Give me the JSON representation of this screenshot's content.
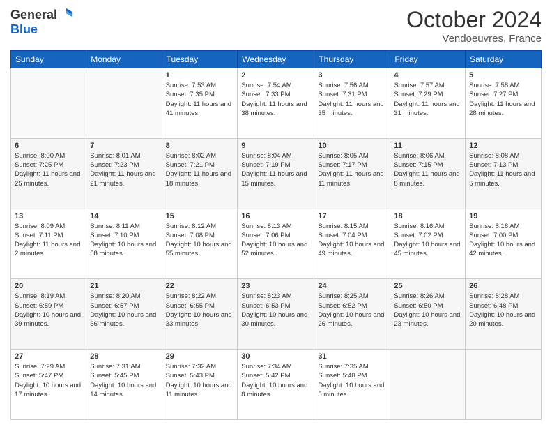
{
  "header": {
    "title": "October 2024",
    "location": "Vendoeuvres, France"
  },
  "columns": [
    "Sunday",
    "Monday",
    "Tuesday",
    "Wednesday",
    "Thursday",
    "Friday",
    "Saturday"
  ],
  "weeks": [
    [
      {
        "day": "",
        "sunrise": "",
        "sunset": "",
        "daylight": ""
      },
      {
        "day": "",
        "sunrise": "",
        "sunset": "",
        "daylight": ""
      },
      {
        "day": "1",
        "sunrise": "Sunrise: 7:53 AM",
        "sunset": "Sunset: 7:35 PM",
        "daylight": "Daylight: 11 hours and 41 minutes."
      },
      {
        "day": "2",
        "sunrise": "Sunrise: 7:54 AM",
        "sunset": "Sunset: 7:33 PM",
        "daylight": "Daylight: 11 hours and 38 minutes."
      },
      {
        "day": "3",
        "sunrise": "Sunrise: 7:56 AM",
        "sunset": "Sunset: 7:31 PM",
        "daylight": "Daylight: 11 hours and 35 minutes."
      },
      {
        "day": "4",
        "sunrise": "Sunrise: 7:57 AM",
        "sunset": "Sunset: 7:29 PM",
        "daylight": "Daylight: 11 hours and 31 minutes."
      },
      {
        "day": "5",
        "sunrise": "Sunrise: 7:58 AM",
        "sunset": "Sunset: 7:27 PM",
        "daylight": "Daylight: 11 hours and 28 minutes."
      }
    ],
    [
      {
        "day": "6",
        "sunrise": "Sunrise: 8:00 AM",
        "sunset": "Sunset: 7:25 PM",
        "daylight": "Daylight: 11 hours and 25 minutes."
      },
      {
        "day": "7",
        "sunrise": "Sunrise: 8:01 AM",
        "sunset": "Sunset: 7:23 PM",
        "daylight": "Daylight: 11 hours and 21 minutes."
      },
      {
        "day": "8",
        "sunrise": "Sunrise: 8:02 AM",
        "sunset": "Sunset: 7:21 PM",
        "daylight": "Daylight: 11 hours and 18 minutes."
      },
      {
        "day": "9",
        "sunrise": "Sunrise: 8:04 AM",
        "sunset": "Sunset: 7:19 PM",
        "daylight": "Daylight: 11 hours and 15 minutes."
      },
      {
        "day": "10",
        "sunrise": "Sunrise: 8:05 AM",
        "sunset": "Sunset: 7:17 PM",
        "daylight": "Daylight: 11 hours and 11 minutes."
      },
      {
        "day": "11",
        "sunrise": "Sunrise: 8:06 AM",
        "sunset": "Sunset: 7:15 PM",
        "daylight": "Daylight: 11 hours and 8 minutes."
      },
      {
        "day": "12",
        "sunrise": "Sunrise: 8:08 AM",
        "sunset": "Sunset: 7:13 PM",
        "daylight": "Daylight: 11 hours and 5 minutes."
      }
    ],
    [
      {
        "day": "13",
        "sunrise": "Sunrise: 8:09 AM",
        "sunset": "Sunset: 7:11 PM",
        "daylight": "Daylight: 11 hours and 2 minutes."
      },
      {
        "day": "14",
        "sunrise": "Sunrise: 8:11 AM",
        "sunset": "Sunset: 7:10 PM",
        "daylight": "Daylight: 10 hours and 58 minutes."
      },
      {
        "day": "15",
        "sunrise": "Sunrise: 8:12 AM",
        "sunset": "Sunset: 7:08 PM",
        "daylight": "Daylight: 10 hours and 55 minutes."
      },
      {
        "day": "16",
        "sunrise": "Sunrise: 8:13 AM",
        "sunset": "Sunset: 7:06 PM",
        "daylight": "Daylight: 10 hours and 52 minutes."
      },
      {
        "day": "17",
        "sunrise": "Sunrise: 8:15 AM",
        "sunset": "Sunset: 7:04 PM",
        "daylight": "Daylight: 10 hours and 49 minutes."
      },
      {
        "day": "18",
        "sunrise": "Sunrise: 8:16 AM",
        "sunset": "Sunset: 7:02 PM",
        "daylight": "Daylight: 10 hours and 45 minutes."
      },
      {
        "day": "19",
        "sunrise": "Sunrise: 8:18 AM",
        "sunset": "Sunset: 7:00 PM",
        "daylight": "Daylight: 10 hours and 42 minutes."
      }
    ],
    [
      {
        "day": "20",
        "sunrise": "Sunrise: 8:19 AM",
        "sunset": "Sunset: 6:59 PM",
        "daylight": "Daylight: 10 hours and 39 minutes."
      },
      {
        "day": "21",
        "sunrise": "Sunrise: 8:20 AM",
        "sunset": "Sunset: 6:57 PM",
        "daylight": "Daylight: 10 hours and 36 minutes."
      },
      {
        "day": "22",
        "sunrise": "Sunrise: 8:22 AM",
        "sunset": "Sunset: 6:55 PM",
        "daylight": "Daylight: 10 hours and 33 minutes."
      },
      {
        "day": "23",
        "sunrise": "Sunrise: 8:23 AM",
        "sunset": "Sunset: 6:53 PM",
        "daylight": "Daylight: 10 hours and 30 minutes."
      },
      {
        "day": "24",
        "sunrise": "Sunrise: 8:25 AM",
        "sunset": "Sunset: 6:52 PM",
        "daylight": "Daylight: 10 hours and 26 minutes."
      },
      {
        "day": "25",
        "sunrise": "Sunrise: 8:26 AM",
        "sunset": "Sunset: 6:50 PM",
        "daylight": "Daylight: 10 hours and 23 minutes."
      },
      {
        "day": "26",
        "sunrise": "Sunrise: 8:28 AM",
        "sunset": "Sunset: 6:48 PM",
        "daylight": "Daylight: 10 hours and 20 minutes."
      }
    ],
    [
      {
        "day": "27",
        "sunrise": "Sunrise: 7:29 AM",
        "sunset": "Sunset: 5:47 PM",
        "daylight": "Daylight: 10 hours and 17 minutes."
      },
      {
        "day": "28",
        "sunrise": "Sunrise: 7:31 AM",
        "sunset": "Sunset: 5:45 PM",
        "daylight": "Daylight: 10 hours and 14 minutes."
      },
      {
        "day": "29",
        "sunrise": "Sunrise: 7:32 AM",
        "sunset": "Sunset: 5:43 PM",
        "daylight": "Daylight: 10 hours and 11 minutes."
      },
      {
        "day": "30",
        "sunrise": "Sunrise: 7:34 AM",
        "sunset": "Sunset: 5:42 PM",
        "daylight": "Daylight: 10 hours and 8 minutes."
      },
      {
        "day": "31",
        "sunrise": "Sunrise: 7:35 AM",
        "sunset": "Sunset: 5:40 PM",
        "daylight": "Daylight: 10 hours and 5 minutes."
      },
      {
        "day": "",
        "sunrise": "",
        "sunset": "",
        "daylight": ""
      },
      {
        "day": "",
        "sunrise": "",
        "sunset": "",
        "daylight": ""
      }
    ]
  ]
}
